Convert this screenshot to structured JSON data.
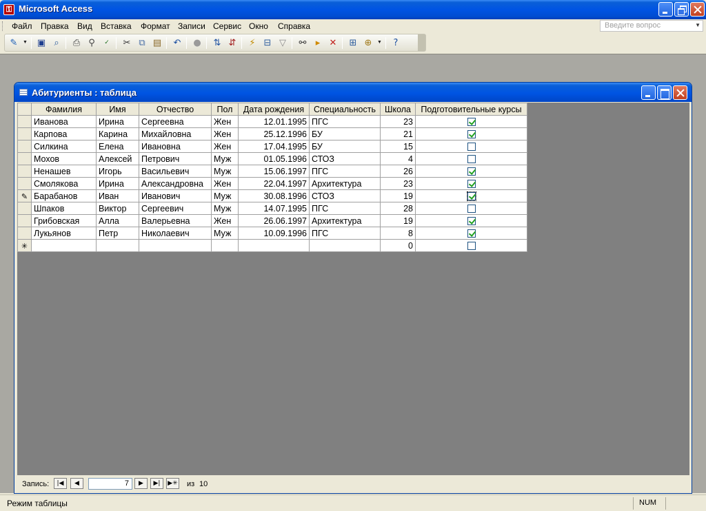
{
  "window": {
    "title": "Microsoft Access"
  },
  "menu": {
    "items": [
      "Файл",
      "Правка",
      "Вид",
      "Вставка",
      "Формат",
      "Записи",
      "Сервис",
      "Окно",
      "Справка"
    ],
    "ask_placeholder": "Введите вопрос"
  },
  "toolbar": {
    "icons": [
      "design-view-icon",
      "save-icon",
      "search-icon",
      "print-icon",
      "print-preview-icon",
      "spelling-icon",
      "cut-icon",
      "copy-icon",
      "paste-icon",
      "undo-icon",
      "hyperlink-icon",
      "sort-ascending-icon",
      "sort-descending-icon",
      "filter-by-selection-icon",
      "filter-by-form-icon",
      "apply-filter-icon",
      "find-icon",
      "new-record-icon",
      "delete-record-icon",
      "database-window-icon",
      "new-object-icon",
      "help-icon"
    ]
  },
  "child_window": {
    "title": "Абитуриенты : таблица"
  },
  "table": {
    "columns": [
      "Фамилия",
      "Имя",
      "Отчество",
      "Пол",
      "Дата рождения",
      "Специальность",
      "Школа",
      "Подготовительные курсы"
    ],
    "rows": [
      [
        "Иванова",
        "Ирина",
        "Сергеевна",
        "Жен",
        "12.01.1995",
        "ПГС",
        "23",
        true
      ],
      [
        "Карпова",
        "Карина",
        "Михайловна",
        "Жен",
        "25.12.1996",
        "БУ",
        "21",
        true
      ],
      [
        "Силкина",
        "Елена",
        "Ивановна",
        "Жен",
        "17.04.1995",
        "БУ",
        "15",
        false
      ],
      [
        "Мохов",
        "Алексей",
        "Петрович",
        "Муж",
        "01.05.1996",
        "СТОЗ",
        "4",
        false
      ],
      [
        "Ненашев",
        "Игорь",
        "Васильевич",
        "Муж",
        "15.06.1997",
        "ПГС",
        "26",
        true
      ],
      [
        "Смолякова",
        "Ирина",
        "Александровна",
        "Жен",
        "22.04.1997",
        "Архитектура",
        "23",
        true
      ],
      [
        "Барабанов",
        "Иван",
        "Иванович",
        "Муж",
        "30.08.1996",
        "СТОЗ",
        "19",
        true
      ],
      [
        "Шпаков",
        "Виктор",
        "Сергеевич",
        "Муж",
        "14.07.1995",
        "ПГС",
        "28",
        false
      ],
      [
        "Грибовская",
        "Алла",
        "Валерьевна",
        "Жен",
        "26.06.1997",
        "Архитектура",
        "19",
        true
      ],
      [
        "Лукьянов",
        "Петр",
        "Николаевич",
        "Муж",
        "10.09.1996",
        "ПГС",
        "8",
        true
      ]
    ],
    "new_row": {
      "school": "0",
      "courses": false
    },
    "current_row_index": 6,
    "new_row_marker": "✳",
    "edit_marker": "✎"
  },
  "navigation": {
    "label": "Запись:",
    "current_record": "7",
    "of_label": "из",
    "total": "10"
  },
  "status": {
    "mode": "Режим таблицы",
    "num": "NUM"
  }
}
